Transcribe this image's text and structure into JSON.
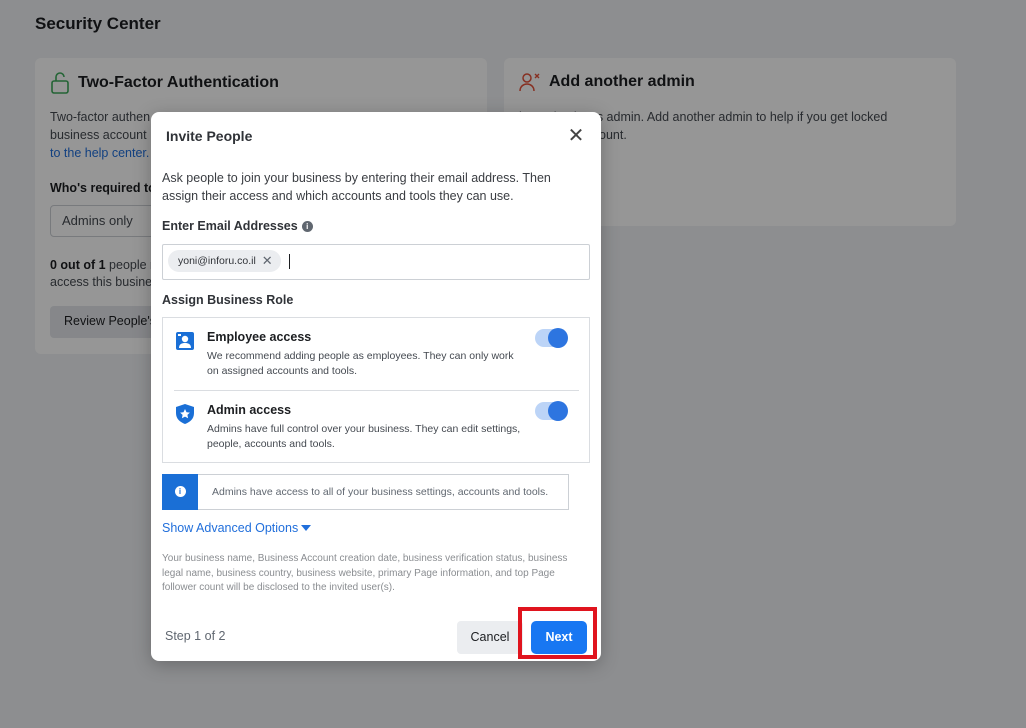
{
  "page": {
    "title": "Security Center"
  },
  "two_factor_card": {
    "title": "Two-Factor Authentication",
    "body_line1": "Two-factor authen",
    "body_line2": "business account",
    "help_link": "to the help center.",
    "required_label": "Who's required to",
    "select_value": "Admins only",
    "count_bold": "0 out of 1",
    "count_line1_rest": " people r",
    "count_line2": "access this busine",
    "review_button": "Review People's"
  },
  "admin_card": {
    "title": "Add another admin",
    "body_line1": "b        business admin. Add another admin to help if you get locked",
    "body_line2": "ount."
  },
  "modal": {
    "title": "Invite People",
    "intro": "Ask people to join your business by entering their email address. Then assign their access and which accounts and tools they can use.",
    "email_label": "Enter Email Addresses",
    "email_chip": "yoni@inforu.co.il",
    "role_label": "Assign Business Role",
    "roles": [
      {
        "name": "Employee access",
        "description": "We recommend adding people as employees. They can only work on assigned accounts and tools.",
        "enabled": true
      },
      {
        "name": "Admin access",
        "description": "Admins have full control over your business. They can edit settings, people, accounts and tools.",
        "enabled": true
      }
    ],
    "info_banner": "Admins have access to all of your business settings, accounts and tools.",
    "advanced_link": "Show Advanced Options",
    "disclaimer": "Your business name, Business Account creation date, business verification status, business legal name, business country, business website, primary Page information, and top Page follower count will be disclosed to the invited user(s).",
    "step": "Step 1 of 2",
    "cancel_button": "Cancel",
    "next_button": "Next"
  },
  "colors": {
    "accent": "#1877f2",
    "highlight": "#e0141e"
  },
  "icons": {
    "lock": "unlock-icon",
    "add_admin": "add-person-icon",
    "employee": "employee-badge-icon",
    "admin": "admin-shield-icon",
    "info": "info-icon",
    "close": "close-icon"
  }
}
